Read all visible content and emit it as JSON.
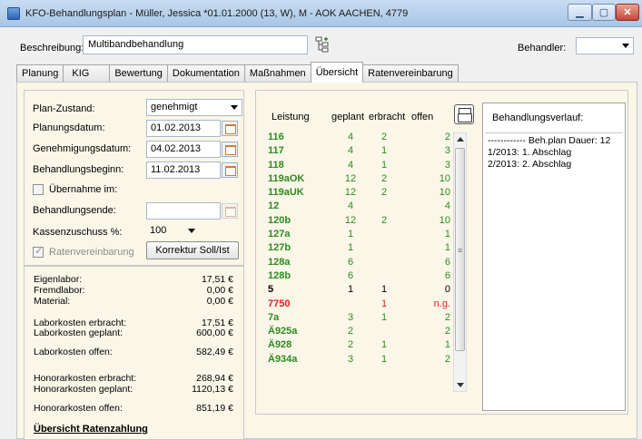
{
  "window": {
    "title": "KFO-Behandlungsplan - Müller, Jessica  *01.01.2000 (13, W),  M - AOK AACHEN,  4779",
    "controls": {
      "minimize": "▁",
      "maximize": "▢",
      "close": "✕"
    }
  },
  "header": {
    "beschreibung_label": "Beschreibung:",
    "beschreibung_value": "Multibandbehandlung",
    "behandler_label": "Behandler:",
    "behandler_value": ""
  },
  "tabs": [
    {
      "label": "Planung"
    },
    {
      "label": "KIG"
    },
    {
      "label": "Bewertung"
    },
    {
      "label": "Dokumentation"
    },
    {
      "label": "Maßnahmen"
    },
    {
      "label": "Übersicht",
      "active": true
    },
    {
      "label": "Ratenvereinbarung"
    }
  ],
  "plan": {
    "zustand_label": "Plan-Zustand:",
    "zustand_value": "genehmigt",
    "planungsdatum_label": "Planungsdatum:",
    "planungsdatum_value": "01.02.2013",
    "genehmigungsdatum_label": "Genehmigungsdatum:",
    "genehmigungsdatum_value": "04.02.2013",
    "behandlungsbeginn_label": "Behandlungsbeginn:",
    "behandlungsbeginn_value": "11.02.2013",
    "uebernahme_label": "Übernahme im:",
    "behandlungsende_label": "Behandlungsende:",
    "behandlungsende_value": "",
    "kassenzuschuss_label": "Kassenzuschuss %:",
    "kassenzuschuss_value": "100",
    "ratenvereinbarung_label": "Ratenvereinbarung",
    "korrektur_button": "Korrektur Soll/Ist"
  },
  "costs": {
    "eigenlabor_label": "Eigenlabor:",
    "eigenlabor_value": "17,51 €",
    "fremdlabor_label": "Fremdlabor:",
    "fremdlabor_value": "0,00 €",
    "material_label": "Material:",
    "material_value": "0,00 €",
    "lab_erbracht_label": "Laborkosten erbracht:",
    "lab_erbracht_value": "17,51 €",
    "lab_geplant_label": "Laborkosten geplant:",
    "lab_geplant_value": "600,00 €",
    "lab_offen_label": "Laborkosten offen:",
    "lab_offen_value": "582,49 €",
    "hon_erbracht_label": "Honorarkosten erbracht:",
    "hon_erbracht_value": "268,94 €",
    "hon_geplant_label": "Honorarkosten geplant:",
    "hon_geplant_value": "1120,13 €",
    "hon_offen_label": "Honorarkosten offen:",
    "hon_offen_value": "851,19 €",
    "raten_heading": "Übersicht Ratenzahlung"
  },
  "leistungen": {
    "headers": [
      "Leistung",
      "geplant",
      "erbracht",
      "offen"
    ],
    "rows": [
      {
        "code": "116",
        "geplant": "4",
        "erbracht": "2",
        "offen": "2",
        "color": "#2e8b1f"
      },
      {
        "code": "117",
        "geplant": "4",
        "erbracht": "1",
        "offen": "3",
        "color": "#2e8b1f"
      },
      {
        "code": "118",
        "geplant": "4",
        "erbracht": "1",
        "offen": "3",
        "color": "#2e8b1f"
      },
      {
        "code": "119aOK",
        "geplant": "12",
        "erbracht": "2",
        "offen": "10",
        "color": "#2e8b1f"
      },
      {
        "code": "119aUK",
        "geplant": "12",
        "erbracht": "2",
        "offen": "10",
        "color": "#2e8b1f"
      },
      {
        "code": "12",
        "geplant": "4",
        "erbracht": "",
        "offen": "4",
        "color": "#2e8b1f"
      },
      {
        "code": "120b",
        "geplant": "12",
        "erbracht": "2",
        "offen": "10",
        "color": "#2e8b1f"
      },
      {
        "code": "127a",
        "geplant": "1",
        "erbracht": "",
        "offen": "1",
        "color": "#2e8b1f"
      },
      {
        "code": "127b",
        "geplant": "1",
        "erbracht": "",
        "offen": "1",
        "color": "#2e8b1f"
      },
      {
        "code": "128a",
        "geplant": "6",
        "erbracht": "",
        "offen": "6",
        "color": "#2e8b1f"
      },
      {
        "code": "128b",
        "geplant": "6",
        "erbracht": "",
        "offen": "6",
        "color": "#2e8b1f"
      },
      {
        "code": "5",
        "geplant": "1",
        "erbracht": "1",
        "offen": "0",
        "color": "#000000"
      },
      {
        "code": "7750",
        "geplant": "",
        "erbracht": "1",
        "offen": "n.g.",
        "color": "#e02020"
      },
      {
        "code": "7a",
        "geplant": "3",
        "erbracht": "1",
        "offen": "2",
        "color": "#2e8b1f"
      },
      {
        "code": "Ä925a",
        "geplant": "2",
        "erbracht": "",
        "offen": "2",
        "color": "#2e8b1f"
      },
      {
        "code": "Ä928",
        "geplant": "2",
        "erbracht": "1",
        "offen": "1",
        "color": "#2e8b1f"
      },
      {
        "code": "Ä934a",
        "geplant": "3",
        "erbracht": "1",
        "offen": "2",
        "color": "#2e8b1f"
      }
    ],
    "scroll_grip": "≡"
  },
  "verlauf": {
    "title": "Behandlungsverlauf:",
    "lines": [
      "------------ Beh.plan Dauer: 12",
      "1/2013: 1. Abschlag",
      "2/2013: 2. Abschlag"
    ]
  }
}
